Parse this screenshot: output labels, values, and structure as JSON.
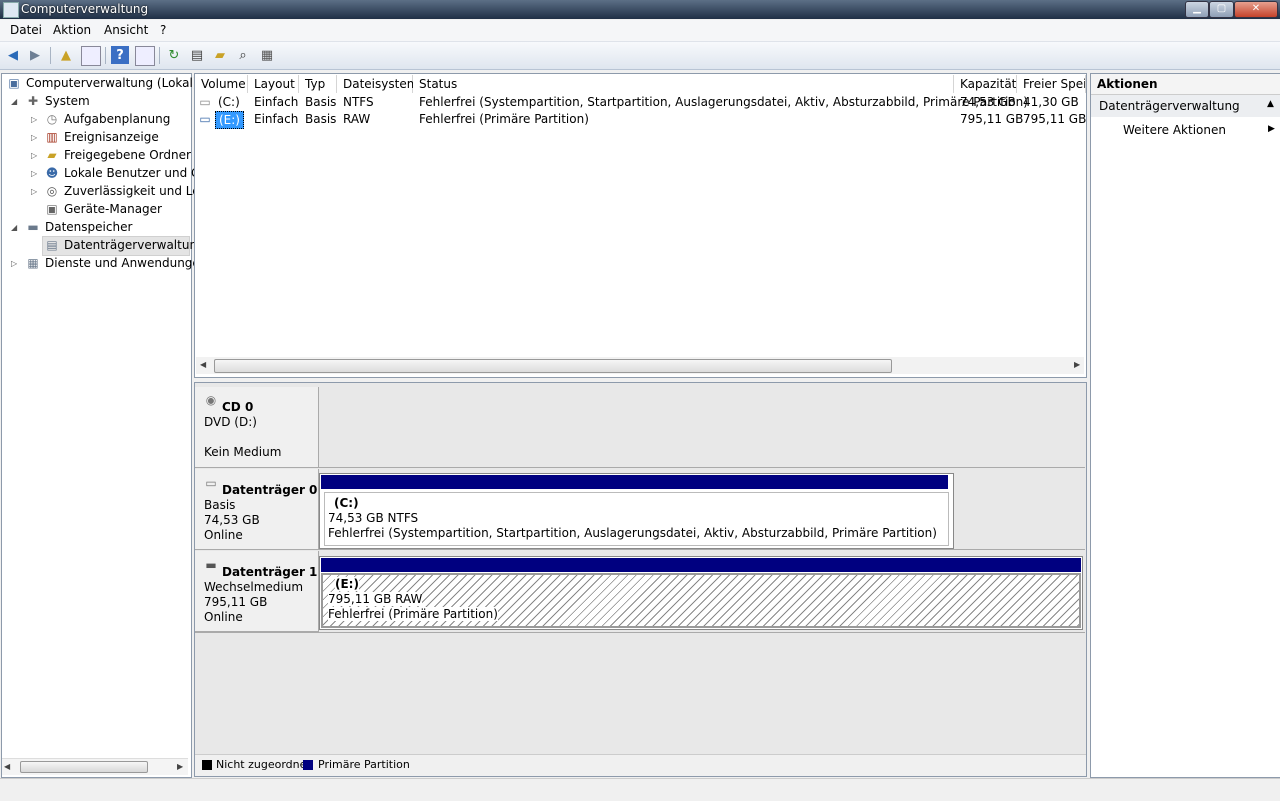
{
  "window": {
    "title": "Computerverwaltung",
    "minimize": "▁",
    "maximize": "▢",
    "close": "✕"
  },
  "menu": {
    "datei": "Datei",
    "aktion": "Aktion",
    "ansicht": "Ansicht",
    "help": "?"
  },
  "tree": {
    "root": "Computerverwaltung (Lokal)",
    "system": "System",
    "aufgabenplanung": "Aufgabenplanung",
    "ereignisanzeige": "Ereignisanzeige",
    "freigegebene": "Freigegebene Ordner",
    "lokale": "Lokale Benutzer und Gru",
    "zuverlaessigkeit": "Zuverlässigkeit und Leis",
    "geraete": "Geräte-Manager",
    "datenspeicher": "Datenspeicher",
    "datentraeger": "Datenträgerverwaltung",
    "dienste": "Dienste und Anwendungen"
  },
  "list": {
    "columns": [
      "Volume",
      "Layout",
      "Typ",
      "Dateisystem",
      "Status",
      "Kapazität",
      "Freier Speic"
    ],
    "rows": [
      [
        "(C:)",
        "Einfach",
        "Basis",
        "NTFS",
        "Fehlerfrei (Systempartition, Startpartition, Auslagerungsdatei, Aktiv, Absturzabbild, Primäre Partition)",
        "74,53 GB",
        "41,30 GB"
      ],
      [
        "(E:)",
        "Einfach",
        "Basis",
        "RAW",
        "Fehlerfrei (Primäre Partition)",
        "795,11 GB",
        "795,11 GB"
      ]
    ]
  },
  "disks": {
    "cd0": {
      "name": "CD 0",
      "line1": "DVD (D:)",
      "line3": "Kein Medium"
    },
    "d0": {
      "name": "Datenträger 0",
      "type": "Basis",
      "size": "74,53 GB",
      "state": "Online",
      "part_name": "(C:)",
      "part_size": "74,53 GB NTFS",
      "part_status": "Fehlerfrei (Systempartition, Startpartition, Auslagerungsdatei, Aktiv, Absturzabbild, Primäre Partition)"
    },
    "d1": {
      "name": "Datenträger 1",
      "type": "Wechselmedium",
      "size": "795,11 GB",
      "state": "Online",
      "part_name": "(E:)",
      "part_size": "795,11 GB RAW",
      "part_status": "Fehlerfrei (Primäre Partition)"
    }
  },
  "legend": {
    "unallocated": "Nicht zugeordnet",
    "primary": "Primäre Partition"
  },
  "actions": {
    "header": "Aktionen",
    "section": "Datenträgerverwaltung",
    "more": "Weitere Aktionen"
  },
  "colors": {
    "primary_partition": "#000080",
    "unallocated": "#000000",
    "selection": "#3399ff"
  }
}
